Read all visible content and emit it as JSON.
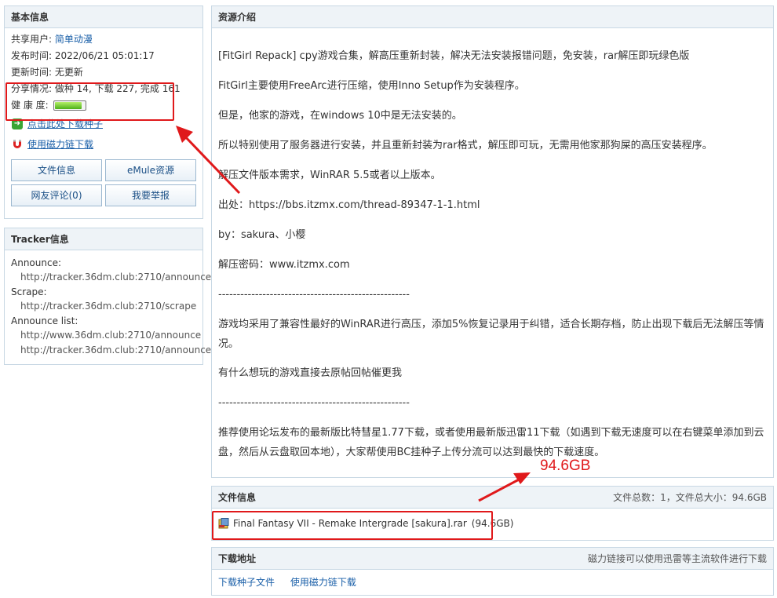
{
  "basic": {
    "title": "基本信息",
    "share_user_label": "共享用户:",
    "share_user": "简单动漫",
    "publish_label": "发布时间:",
    "publish_time": "2022/06/21 05:01:17",
    "update_label": "更新时间:",
    "update_value": "无更新",
    "share_status": "分享情况: 做种 14, 下载 227, 完成 161",
    "health_label": "健 康 度:",
    "health_level": 0.9,
    "seed_link": "点击此处下载种子",
    "magnet_link": "使用磁力链下载",
    "buttons": [
      "文件信息",
      "eMule资源",
      "网友评论(0)",
      "我要举报"
    ]
  },
  "tracker": {
    "title": "Tracker信息",
    "announce_label": "Announce:",
    "announce_url": "http://tracker.36dm.club:2710/announce",
    "scrape_label": "Scrape:",
    "scrape_url": "http://tracker.36dm.club:2710/scrape",
    "list_label": "Announce list:",
    "list_urls": [
      "http://www.36dm.club:2710/announce",
      "http://tracker.36dm.club:2710/announce"
    ]
  },
  "intro": {
    "title": "资源介绍",
    "paragraphs": [
      "[FitGirl Repack] cpy游戏合集，解高压重新封装，解决无法安装报错问题，免安装，rar解压即玩绿色版",
      "FitGirl主要使用FreeArc进行压缩，使用Inno Setup作为安装程序。",
      "但是，他家的游戏，在windows 10中是无法安装的。",
      "所以特别使用了服务器进行安装，并且重新封装为rar格式，解压即可玩，无需用他家那狗屎的高压安装程序。",
      "解压文件版本需求，WinRAR 5.5或者以上版本。",
      "出处：https://bbs.itzmx.com/thread-89347-1-1.html",
      "by：sakura、小樱",
      "解压密码：www.itzmx.com",
      "----------------------------------------------------",
      "游戏均采用了兼容性最好的WinRAR进行高压，添加5%恢复记录用于纠错，适合长期存档，防止出现下载后无法解压等情况。",
      "有什么想玩的游戏直接去原帖回帖催更我",
      "----------------------------------------------------",
      "推荐使用论坛发布的最新版比特彗星1.77下载，或者使用最新版迅雷11下载（如遇到下载无速度可以在右键菜单添加到云盘，然后从云盘取回本地），大家帮使用BC挂种子上传分流可以达到最快的下载速度。"
    ]
  },
  "fileinfo": {
    "title": "文件信息",
    "summary": "文件总数：1，文件总大小：94.6GB",
    "file_name": "Final Fantasy VII - Remake Intergrade [sakura].rar",
    "file_size": "(94.6GB)"
  },
  "download": {
    "title": "下载地址",
    "hint": "磁力链接可以使用迅雷等主流软件进行下载",
    "seed_file": "下载种子文件",
    "magnet": "使用磁力链下载"
  },
  "annotation": {
    "size_label": "94.6GB",
    "color": "#e0191b"
  }
}
